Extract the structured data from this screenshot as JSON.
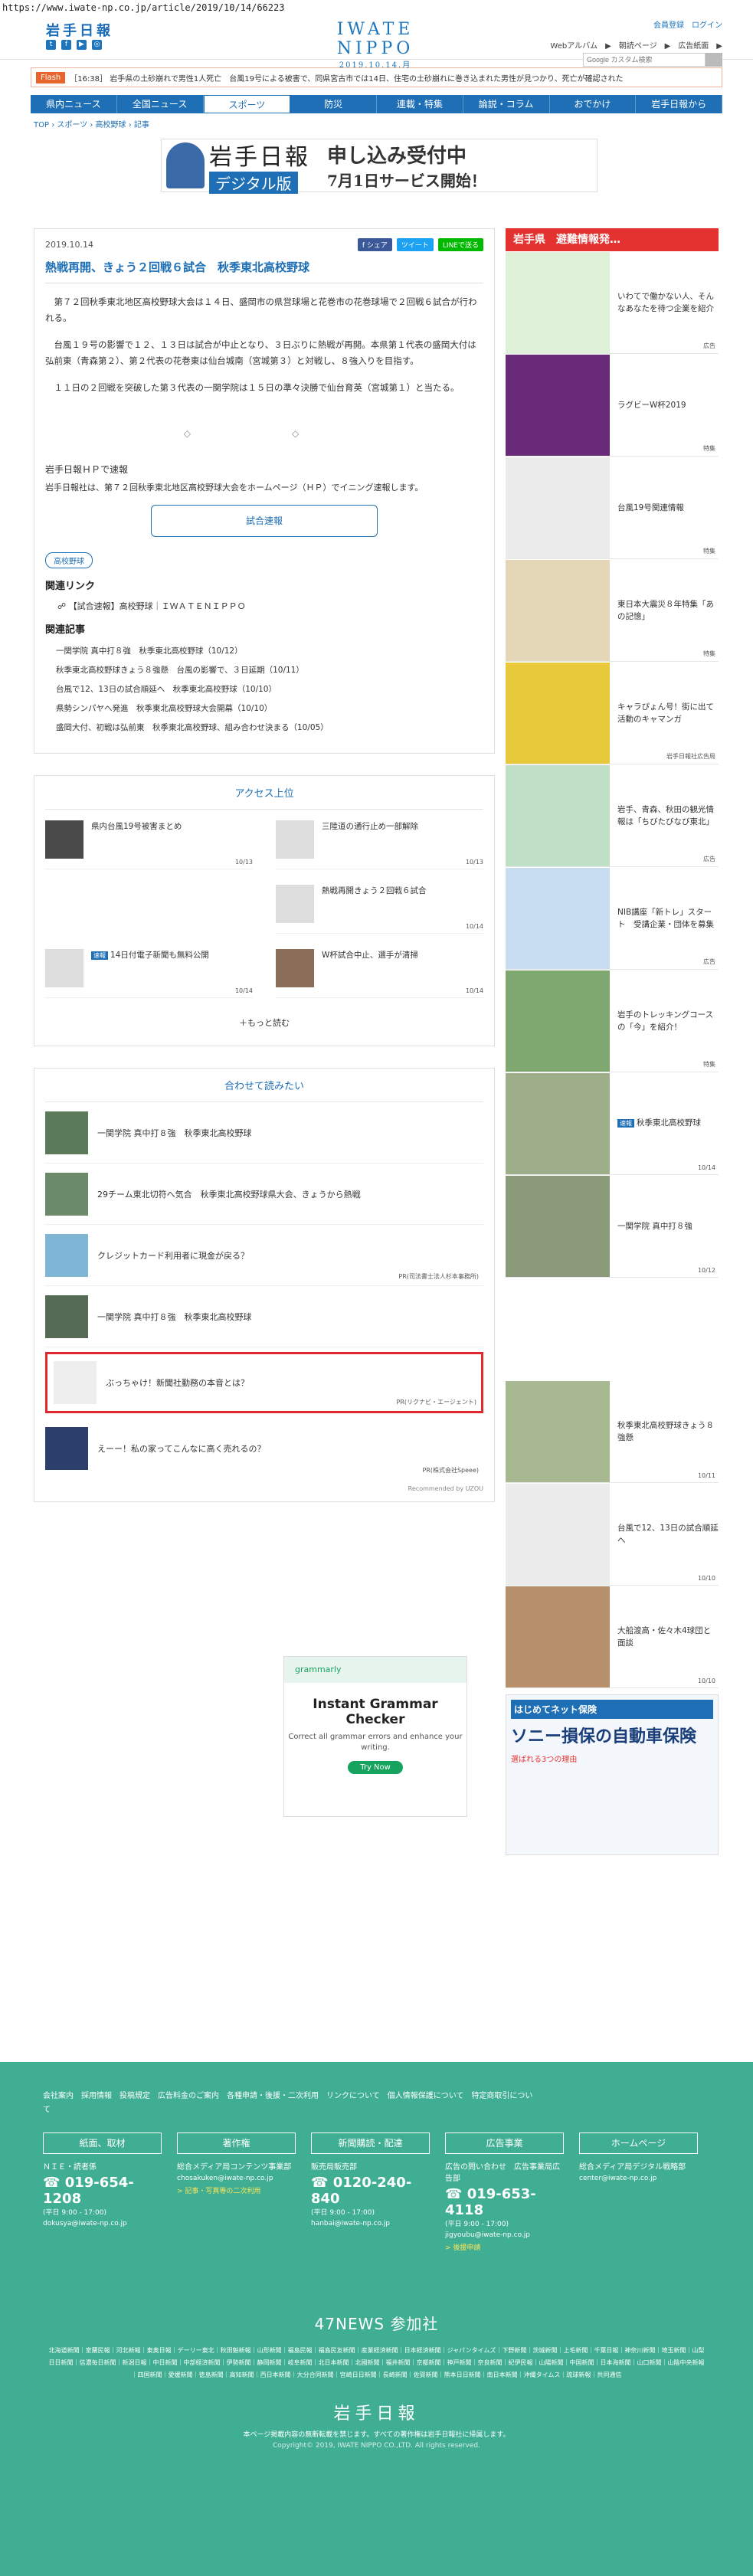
{
  "url": "https://www.iwate-np.co.jp/article/2019/10/14/66223",
  "header": {
    "brand": "岩手日報",
    "logo": "IWATE NIPPO",
    "date": "2019.10.14.月",
    "member_links": "会員登録　ログイン",
    "nav_links": "Webアルバム　▶　朝読ページ　▶　広告紙面　▶",
    "search_placeholder": "Google カスタム検索"
  },
  "flash": {
    "label": "Flash",
    "text": "［16:38］ 岩手県の土砂崩れで男性1人死亡　台風19号による被害で、同県宮古市では14日、住宅の土砂崩れに巻き込まれた男性が見つかり、死亡が確認された"
  },
  "nav": [
    "県内ニュース",
    "全国ニュース",
    "スポーツ",
    "防災",
    "連載・特集",
    "論説・コラム",
    "おでかけ",
    "岩手日報から"
  ],
  "breadcrumb": "TOP › スポーツ › 高校野球 › 記事",
  "banner": {
    "title": "岩手日報",
    "sub": "デジタル版",
    "right1": "申し込み受付中",
    "right2": "7月1日サービス開始！"
  },
  "article": {
    "date": "2019.10.14",
    "share_fb": "f シェア",
    "share_tw": "ツイート",
    "share_line": "LINEで送る",
    "headline": "熱戦再開、きょう２回戦６試合　秋季東北高校野球",
    "p1": "第７２回秋季東北地区高校野球大会は１４日、盛岡市の県営球場と花巻市の花巻球場で２回戦６試合が行われる。",
    "p2": "台風１９号の影響で１２、１３日は試合が中止となり、３日ぶりに熱戦が再開。本県第１代表の盛岡大付は弘前東（青森第２）、第２代表の花巻東は仙台城南（宮城第３）と対戦し、８強入りを目指す。",
    "p3": "１１日の２回戦を突破した第３代表の一関学院は１５日の準々決勝で仙台育英（宮城第１）と当たる。",
    "diamonds": "◇　◇",
    "hp_title": "岩手日報ＨＰで速報",
    "hp_body": "岩手日報社は、第７２回秋季東北地区高校野球大会をホームページ（ＨＰ）でイニング速報します。",
    "sokuho": "試合速報",
    "tag": "高校野球",
    "related_links_title": "関連リンク",
    "related_link": "【試合速報】高校野球｜ＩＷＡＴＥＮＩＰＰＯ",
    "related_articles_title": "関連記事",
    "related_articles": [
      "一関学院 真中打８強　秋季東北高校野球（10/12）",
      "秋季東北高校野球きょう８強懸　台風の影響で、３日延期（10/11）",
      "台風で12、13日の試合順延へ　秋季東北高校野球（10/10）",
      "県勢シンパヤへ発進　秋季東北高校野球大会開幕（10/10）",
      "盛岡大付、初戦は弘前東　秋季東北高校野球、組み合わせ決まる（10/05）"
    ]
  },
  "ranking": {
    "title": "アクセス上位",
    "items": [
      {
        "title": "県内台風19号被害まとめ",
        "date": "10/13",
        "badge": ""
      },
      {
        "title": "三陸道の通行止め一部解除",
        "date": "10/13",
        "badge": ""
      },
      {
        "title": "",
        "date": "",
        "badge": ""
      },
      {
        "title": "熱戦再開きょう２回戦６試合",
        "date": "10/14",
        "badge": ""
      },
      {
        "title": "14日付電子新聞も無料公開",
        "date": "10/14",
        "badge": "速報"
      },
      {
        "title": "W杯試合中止、選手が清掃",
        "date": "10/14",
        "badge": ""
      }
    ],
    "more": "＋もっと読む"
  },
  "together": {
    "title": "合わせて読みたい",
    "items": [
      {
        "title": "一関学院 真中打８強　秋季東北高校野球",
        "pr": ""
      },
      {
        "title": "29チーム東北切符へ気合　秋季東北高校野球県大会、きょうから熱戦",
        "pr": ""
      },
      {
        "title": "クレジットカード利用者に現金が戻る？",
        "pr": "PR(司法書士法人杉本事務所)"
      },
      {
        "title": "一関学院 真中打８強　秋季東北高校野球",
        "pr": ""
      },
      {
        "title": "ぶっちゃけ！新聞社勤務の本音とは？",
        "pr": "PR(リクナビ・エージェント)"
      },
      {
        "title": "えーー！私の家ってこんなに高く売れるの？",
        "pr": "PR(株式会社Speee)"
      }
    ],
    "recommended": "Recommended by UZOU"
  },
  "ad_grammarly": {
    "brand": "grammarly",
    "headline": "Instant Grammar Checker",
    "body": "Correct all grammar errors and enhance your writing.",
    "button": "Try Now"
  },
  "side": {
    "refuge": "岩手県　避難情報発…",
    "items": [
      {
        "title": "いわてで働かない人、そんなあなたを待つ企業を紹介",
        "tag": "広告"
      },
      {
        "title": "ラグビーW杯2019",
        "tag": "特集"
      },
      {
        "title": "台風19号関連情報",
        "tag": "特集"
      },
      {
        "title": "東日本大震災８年特集「あの記憶」",
        "tag": "特集"
      },
      {
        "title": "キャラぴょん号！街に出て活動のキャマンガ",
        "tag": "岩手日報社広告局"
      },
      {
        "title": "岩手、青森、秋田の観光情報は「ちびたびなび東北」",
        "tag": "広告"
      },
      {
        "title": "NIB講座「新トレ」スタート　受講企業・団体を募集",
        "tag": "広告"
      },
      {
        "title": "岩手のトレッキングコースの「今」を紹介！",
        "tag": "特集"
      },
      {
        "title": "秋季東北高校野球",
        "tag": "10/14",
        "badge": "速報"
      },
      {
        "title": "一関学院 真中打８強",
        "tag": "10/12"
      },
      {
        "title": "",
        "tag": ""
      },
      {
        "title": "秋季東北高校野球きょう８強懸",
        "tag": "10/11"
      },
      {
        "title": "台風で12、13日の試合順延へ",
        "tag": "10/10"
      },
      {
        "title": "大船渡高・佐々木4球団と面談",
        "tag": "10/10"
      }
    ],
    "ad_title": "はじめてネット保険",
    "ad_main": "ソニー損保の自動車保険",
    "ad_sub": "選ばれる3つの理由"
  },
  "footer": {
    "links": "会社案内　採用情報　投稿規定　広告料金のご案内　各種申請・後援・二次利用　リンクについて　個人情報保護について　特定商取引について",
    "cols": [
      {
        "title": "紙面、取材",
        "sub": "ＮＩＥ・読者係",
        "tel": "019-654-1208",
        "hr": "(平日 9:00 - 17:00)",
        "em": "dokusya@iwate-np.co.jp",
        "pk": ""
      },
      {
        "title": "著作権",
        "sub": "総合メディア局コンテンツ事業部",
        "tel": "",
        "hr": "",
        "em": "chosakuken@iwate-np.co.jp",
        "pk": "> 記事・写真等の二次利用"
      },
      {
        "title": "新聞購読・配達",
        "sub": "販売局販売部",
        "tel": "0120-240-840",
        "hr": "(平日 9:00 - 17:00)",
        "em": "hanbai@iwate-np.co.jp",
        "pk": ""
      },
      {
        "title": "広告事業",
        "sub": "広告の問い合わせ　広告事業局広告部",
        "tel": "019-653-4118",
        "hr": "(平日 9:00 - 17:00)",
        "em": "jigyoubu@iwate-np.co.jp",
        "pk": "> 後援申請"
      },
      {
        "title": "ホームページ",
        "sub": "総合メディア局デジタル戦略部",
        "tel": "",
        "hr": "",
        "em": "center@iwate-np.co.jp",
        "pk": ""
      }
    ],
    "n47": "47NEWS 参加社",
    "n47list": "北海道新聞｜室蘭民報｜河北新報｜東奥日報｜デーリー東北｜秋田魁新報｜山形新聞｜福島民報｜福島民友新聞｜産業経済新聞｜日本経済新聞｜ジャパンタイムズ｜下野新聞｜茨城新聞｜上毛新聞｜千葉日報｜神奈川新聞｜埼玉新聞｜山梨日日新聞｜信濃毎日新聞｜新潟日報｜中日新聞｜中部経済新聞｜伊勢新聞｜静岡新聞｜岐阜新聞｜北日本新聞｜北國新聞｜福井新聞｜京都新聞｜神戸新聞｜奈良新聞｜紀伊民報｜山陽新聞｜中国新聞｜日本海新聞｜山口新聞｜山陰中央新報｜四国新聞｜愛媛新聞｜徳島新聞｜高知新聞｜西日本新聞｜大分合同新聞｜宮崎日日新聞｜長崎新聞｜佐賀新聞｜熊本日日新聞｜南日本新聞｜沖縄タイムス｜琉球新報｜共同通信",
    "logo": "岩手日報",
    "copy1": "本ページ掲載内容の無断転載を禁じます。すべての著作権は岩手日報社に帰属します。",
    "copy2": "Copyright© 2019, IWATE NIPPO CO.,LTD. All rights reserved."
  }
}
